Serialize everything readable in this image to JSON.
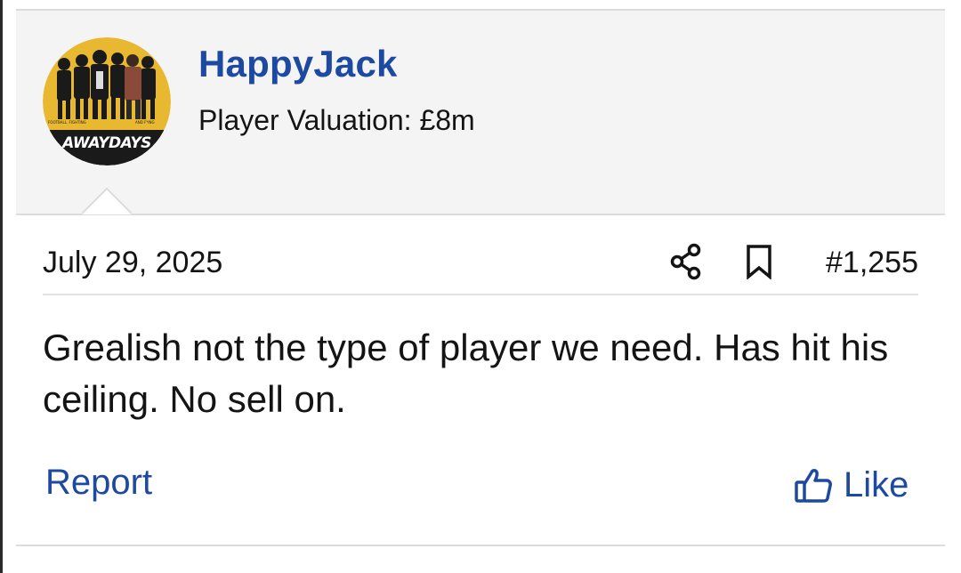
{
  "user": {
    "name": "HappyJack",
    "title": "Player Valuation: £8m",
    "avatar_text": "AWAYDAYS"
  },
  "post": {
    "date": "July 29, 2025",
    "number": "#1,255",
    "message": "Grealish not the type of player we need. Has hit his ceiling. No sell on."
  },
  "actions": {
    "report_label": "Report",
    "like_label": "Like"
  },
  "icons": {
    "share": "share-icon",
    "bookmark": "bookmark-icon",
    "like": "thumbs-up-icon"
  },
  "colors": {
    "link": "#1d4aa0",
    "user_block_bg": "#f4f4f4",
    "avatar_gold": "#e8b830"
  }
}
